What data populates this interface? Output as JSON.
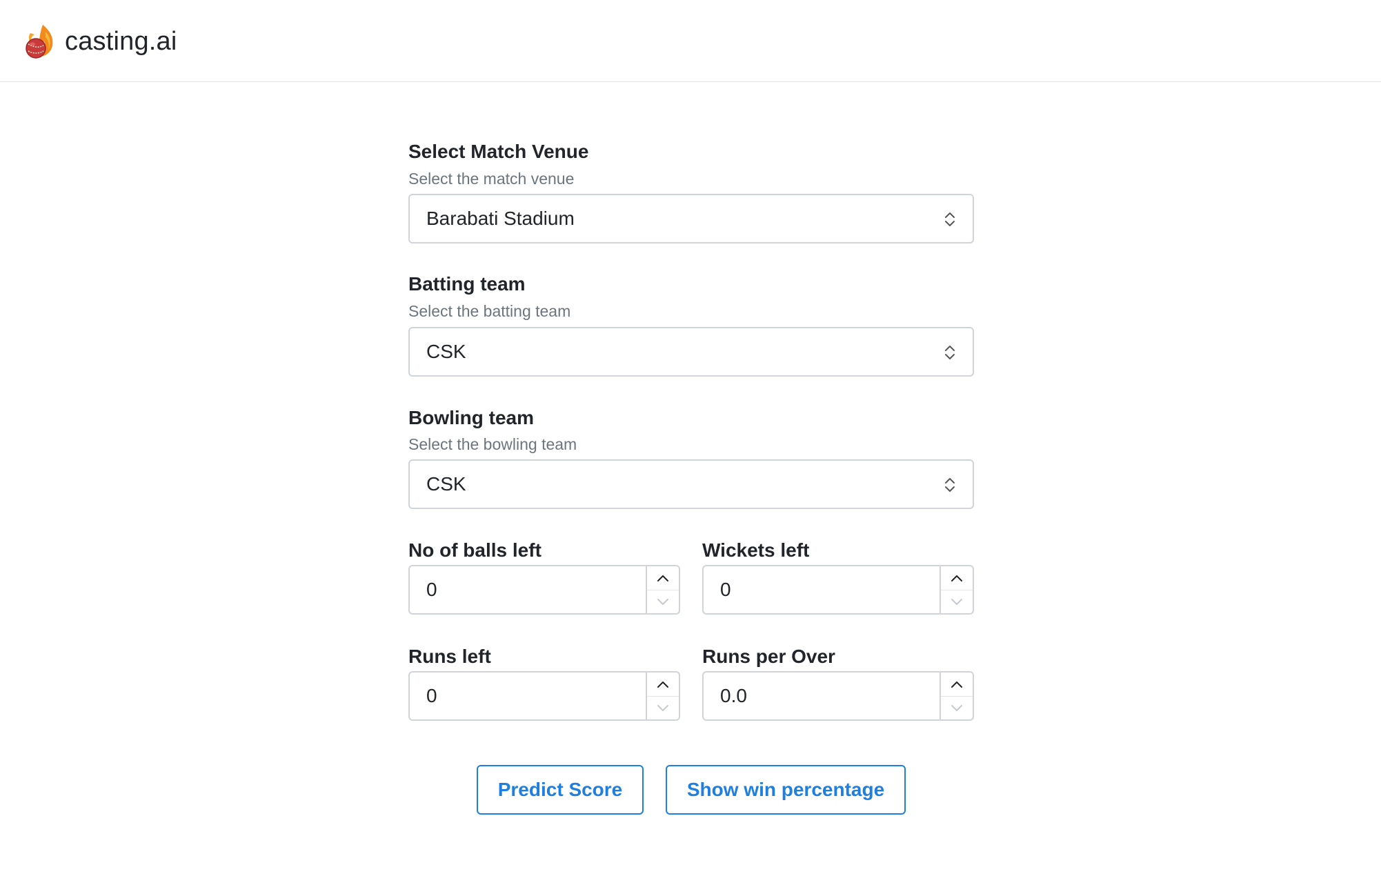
{
  "app": {
    "brand": "casting.ai",
    "logo_icon": "flaming-cricket-ball-icon"
  },
  "form": {
    "venue": {
      "label": "Select Match Venue",
      "help": "Select the match venue",
      "value": "Barabati Stadium"
    },
    "batting_team": {
      "label": "Batting team",
      "help": "Select the batting team",
      "value": "CSK"
    },
    "bowling_team": {
      "label": "Bowling team",
      "help": "Select the bowling team",
      "value": "CSK"
    },
    "balls_left": {
      "label": "No of balls left",
      "value": "0"
    },
    "wickets_left": {
      "label": "Wickets left",
      "value": "0"
    },
    "runs_left": {
      "label": "Runs left",
      "value": "0"
    },
    "runs_per_over": {
      "label": "Runs per Over",
      "value": "0.0"
    }
  },
  "actions": {
    "predict_score": "Predict Score",
    "show_win_percentage": "Show win percentage"
  },
  "colors": {
    "accent": "#1f7fe0",
    "border": "#d0d4d9",
    "help_text": "#6c757d",
    "text": "#212529"
  }
}
